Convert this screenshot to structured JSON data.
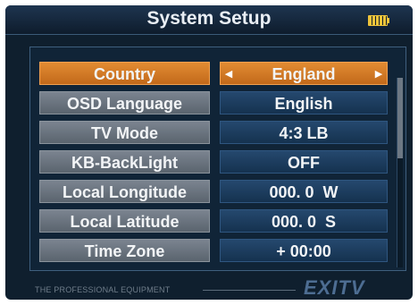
{
  "header": {
    "title": "System Setup",
    "battery_icon": "battery-icon"
  },
  "settings": [
    {
      "label": "Country",
      "value": "England",
      "selected": true
    },
    {
      "label": "OSD Language",
      "value": "English"
    },
    {
      "label": "TV Mode",
      "value": "4:3 LB"
    },
    {
      "label": "KB-BackLight",
      "value": "OFF"
    },
    {
      "label": "Local Longitude",
      "value": "000. 0  W"
    },
    {
      "label": "Local Latitude",
      "value": "000. 0  S"
    },
    {
      "label": "Time Zone",
      "value": "+ 00:00"
    }
  ],
  "footer": {
    "tagline": "THE PROFESSIONAL EQUIPMENT",
    "brand": "EXITV"
  },
  "colors": {
    "selected": "#d87b28",
    "label_bg": "#6b7480",
    "value_bg": "#1d3d60",
    "background": "#0f1f2e"
  }
}
